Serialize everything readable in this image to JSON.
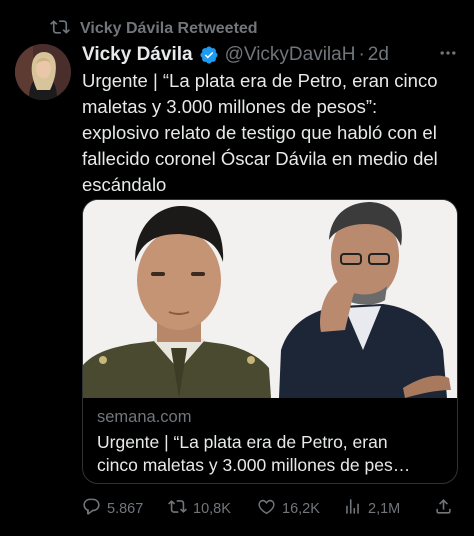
{
  "retweet_banner": {
    "text": "Vicky Dávila Retweeted",
    "icon": "retweet-icon"
  },
  "author": {
    "name": "Vicky Dávila",
    "handle": "@VickyDavilaH",
    "separator": "·",
    "time": "2d",
    "verified_color": "#1d9bf0"
  },
  "tweet": {
    "lines": [
      "Urgente | “La plata era de Petro, eran cinco",
      "maletas y 3.000 millones de pesos”:",
      "explosivo relato de testigo que habló con el",
      "fallecido coronel Óscar Dávila en medio del",
      "escándalo"
    ]
  },
  "card": {
    "domain": "semana.com",
    "title_lines": [
      "Urgente | “La plata era de Petro, eran",
      "cinco maletas y 3.000 millones de pes…"
    ]
  },
  "actions": {
    "replies": "5.867",
    "retweets": "10,8K",
    "likes": "16,2K",
    "views": "2,1M"
  },
  "colors": {
    "background": "#000000",
    "text": "#e7e9ea",
    "muted": "#71767b",
    "border": "#2f3336"
  }
}
